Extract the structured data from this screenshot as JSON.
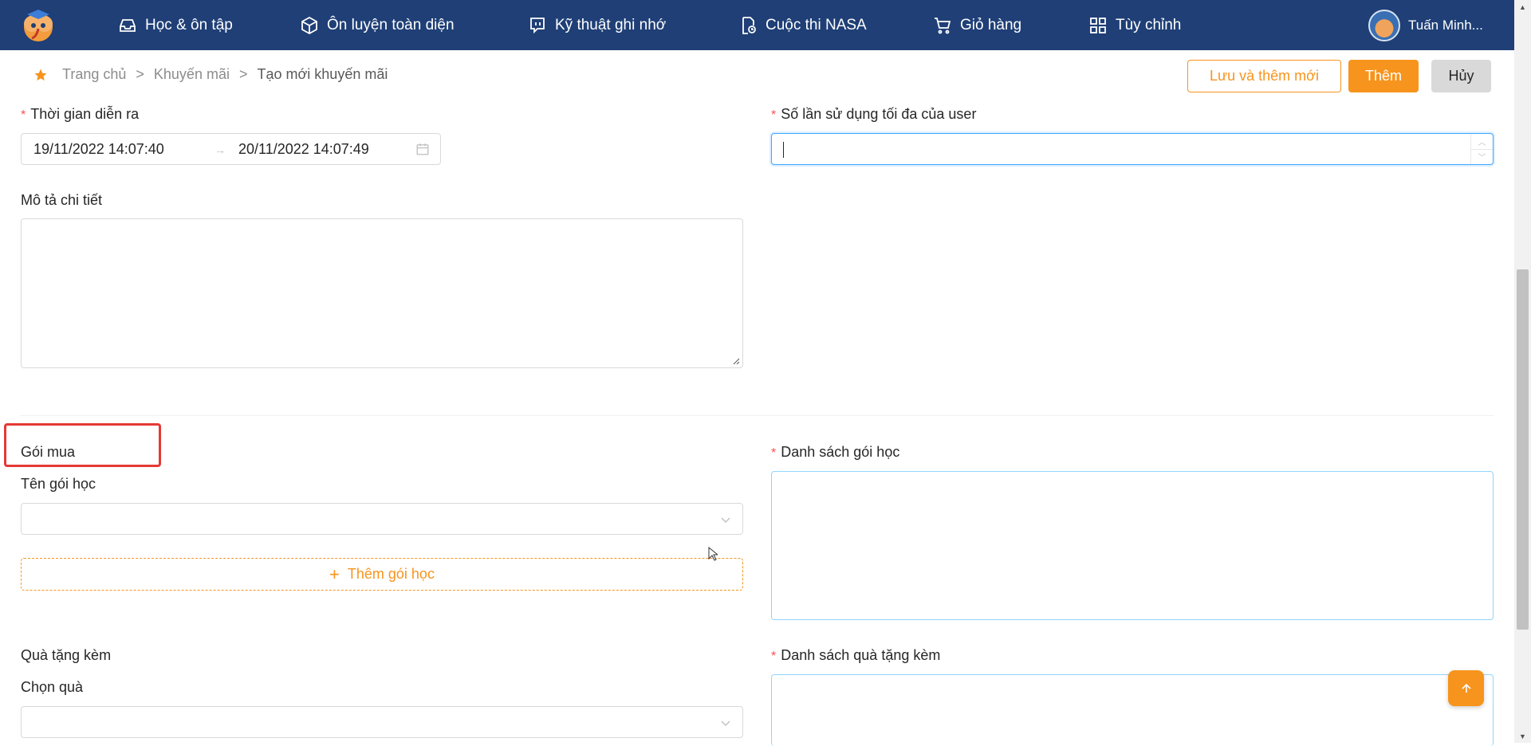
{
  "nav": {
    "items": [
      {
        "label": "Học & ôn tập",
        "icon": "inbox-icon"
      },
      {
        "label": "Ôn luyện toàn diện",
        "icon": "box-icon"
      },
      {
        "label": "Kỹ thuật ghi nhớ",
        "icon": "chat-bubble-icon"
      },
      {
        "label": "Cuộc thi NASA",
        "icon": "document-clock-icon"
      },
      {
        "label": "Giỏ hàng",
        "icon": "cart-icon"
      },
      {
        "label": "Tùy chỉnh",
        "icon": "grid-icon"
      }
    ],
    "user_name": "Tuấn Minh..."
  },
  "breadcrumb": {
    "home": "Trang chủ",
    "parent": "Khuyến mãi",
    "current": "Tạo mới khuyến mãi",
    "separator": ">"
  },
  "actions": {
    "save_and_new": "Lưu và thêm mới",
    "add": "Thêm",
    "cancel": "Hủy"
  },
  "form": {
    "time_label": "Thời gian diễn ra",
    "time_start": "19/11/2022 14:07:40",
    "time_end": "20/11/2022 14:07:49",
    "range_separator": "→",
    "max_usage_label": "Số lần sử dụng tối đa của user",
    "max_usage_value": "",
    "description_label": "Mô tả chi tiết",
    "description_value": ""
  },
  "packages": {
    "section_title": "Gói mua",
    "name_label": "Tên gói học",
    "add_button": "Thêm gói học",
    "list_label": "Danh sách gói học"
  },
  "gifts": {
    "section_title": "Quà tặng kèm",
    "choose_label": "Chọn quà",
    "list_label": "Danh sách quà tặng kèm"
  },
  "colors": {
    "nav_bg": "#1f3f76",
    "accent": "#f7941d",
    "required": "#ff4d4f",
    "highlight": "#e53935"
  }
}
